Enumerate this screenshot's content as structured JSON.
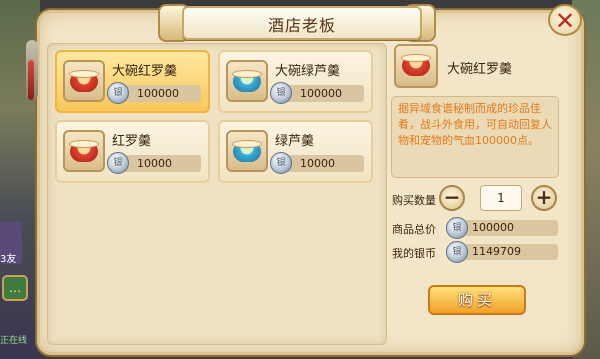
{
  "window": {
    "title": "酒店老板",
    "close_label": "✕"
  },
  "items": [
    {
      "name": "大碗红罗羹",
      "price": "100000",
      "bowl": "red",
      "selected": true
    },
    {
      "name": "大碗绿芦羹",
      "price": "100000",
      "bowl": "green",
      "selected": false
    },
    {
      "name": "红罗羹",
      "price": "10000",
      "bowl": "red",
      "selected": false
    },
    {
      "name": "绿芦羹",
      "price": "10000",
      "bowl": "green",
      "selected": false
    }
  ],
  "detail": {
    "name": "大碗红罗羹",
    "description": "据异域食谱秘制而成的珍品佳肴，战斗外食用，可自动回复人物和宠物的气血100000点。"
  },
  "purchase": {
    "quantity_label": "购买数量",
    "quantity": "1",
    "minus_label": "−",
    "plus_label": "+",
    "total_label": "商品总价",
    "total": "100000",
    "silver_label": "我的银币",
    "silver": "1149709",
    "buy_label": "购买"
  },
  "side": {
    "chat_icon": "…",
    "text1": "3友",
    "text2": "正在线"
  },
  "colors": {
    "accent": "#f2a12a",
    "description": "#e37a1a",
    "close": "#c0261c"
  }
}
